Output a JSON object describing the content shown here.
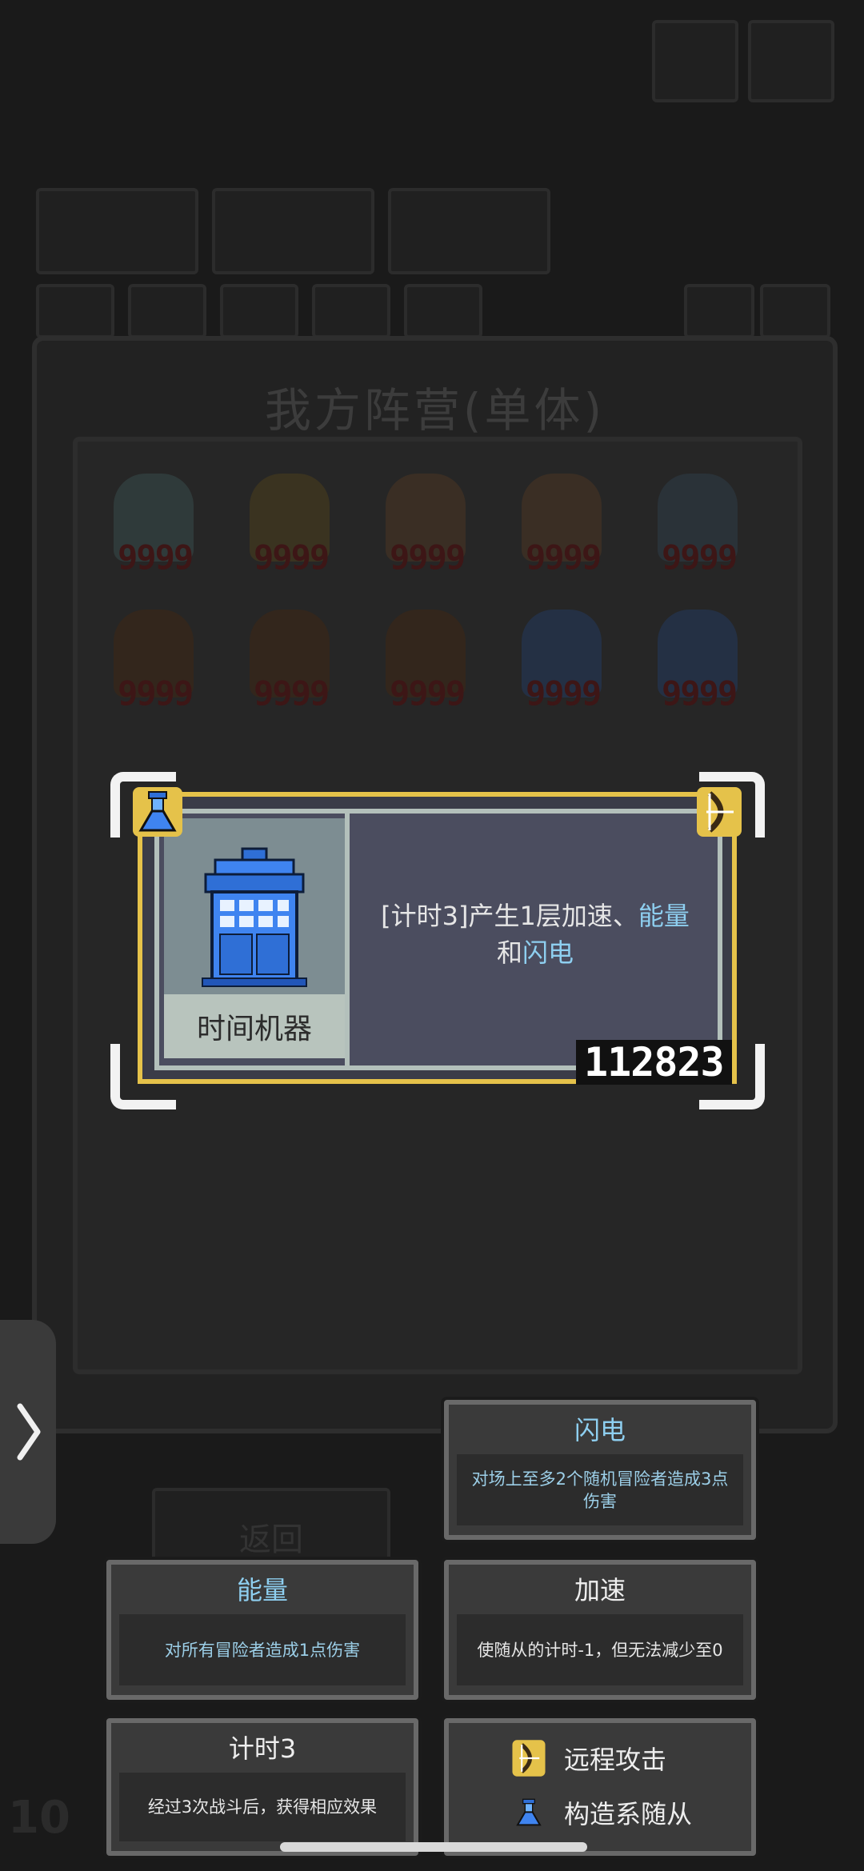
{
  "panel": {
    "title": "我方阵营(单体)"
  },
  "units": [
    {
      "hp": "9999"
    },
    {
      "hp": "9999"
    },
    {
      "hp": "9999"
    },
    {
      "hp": "9999"
    },
    {
      "hp": "9999"
    },
    {
      "hp": "9999"
    },
    {
      "hp": "9999"
    },
    {
      "hp": "9999"
    },
    {
      "hp": "9999"
    },
    {
      "hp": "9999"
    }
  ],
  "card": {
    "name": "时间机器",
    "desc_prefix": "[计时3]产生1层加速、",
    "desc_kw1": "能量",
    "desc_mid": "和",
    "desc_kw2": "闪电",
    "code": "112823",
    "type_icon": "flask-icon",
    "tag_icon": "bow-icon"
  },
  "tips": {
    "lightning": {
      "title": "闪电",
      "body": "对场上至多2个随机冒险者造成3点伤害"
    },
    "energy": {
      "title": "能量",
      "body": "对所有冒险者造成1点伤害"
    },
    "haste": {
      "title": "加速",
      "body": "使随从的计时-1，但无法减少至0"
    },
    "timer": {
      "title": "计时3",
      "body": "经过3次战斗后，获得相应效果"
    }
  },
  "legend": [
    {
      "icon": "bow-icon",
      "label": "远程攻击"
    },
    {
      "icon": "flask-icon",
      "label": "构造系随从"
    }
  ],
  "bg": {
    "return_label": "返回",
    "level": "10"
  },
  "colors": {
    "gold": "#e5c24a",
    "keyword": "#8ecff0",
    "card_bg": "#4b4d5f"
  }
}
